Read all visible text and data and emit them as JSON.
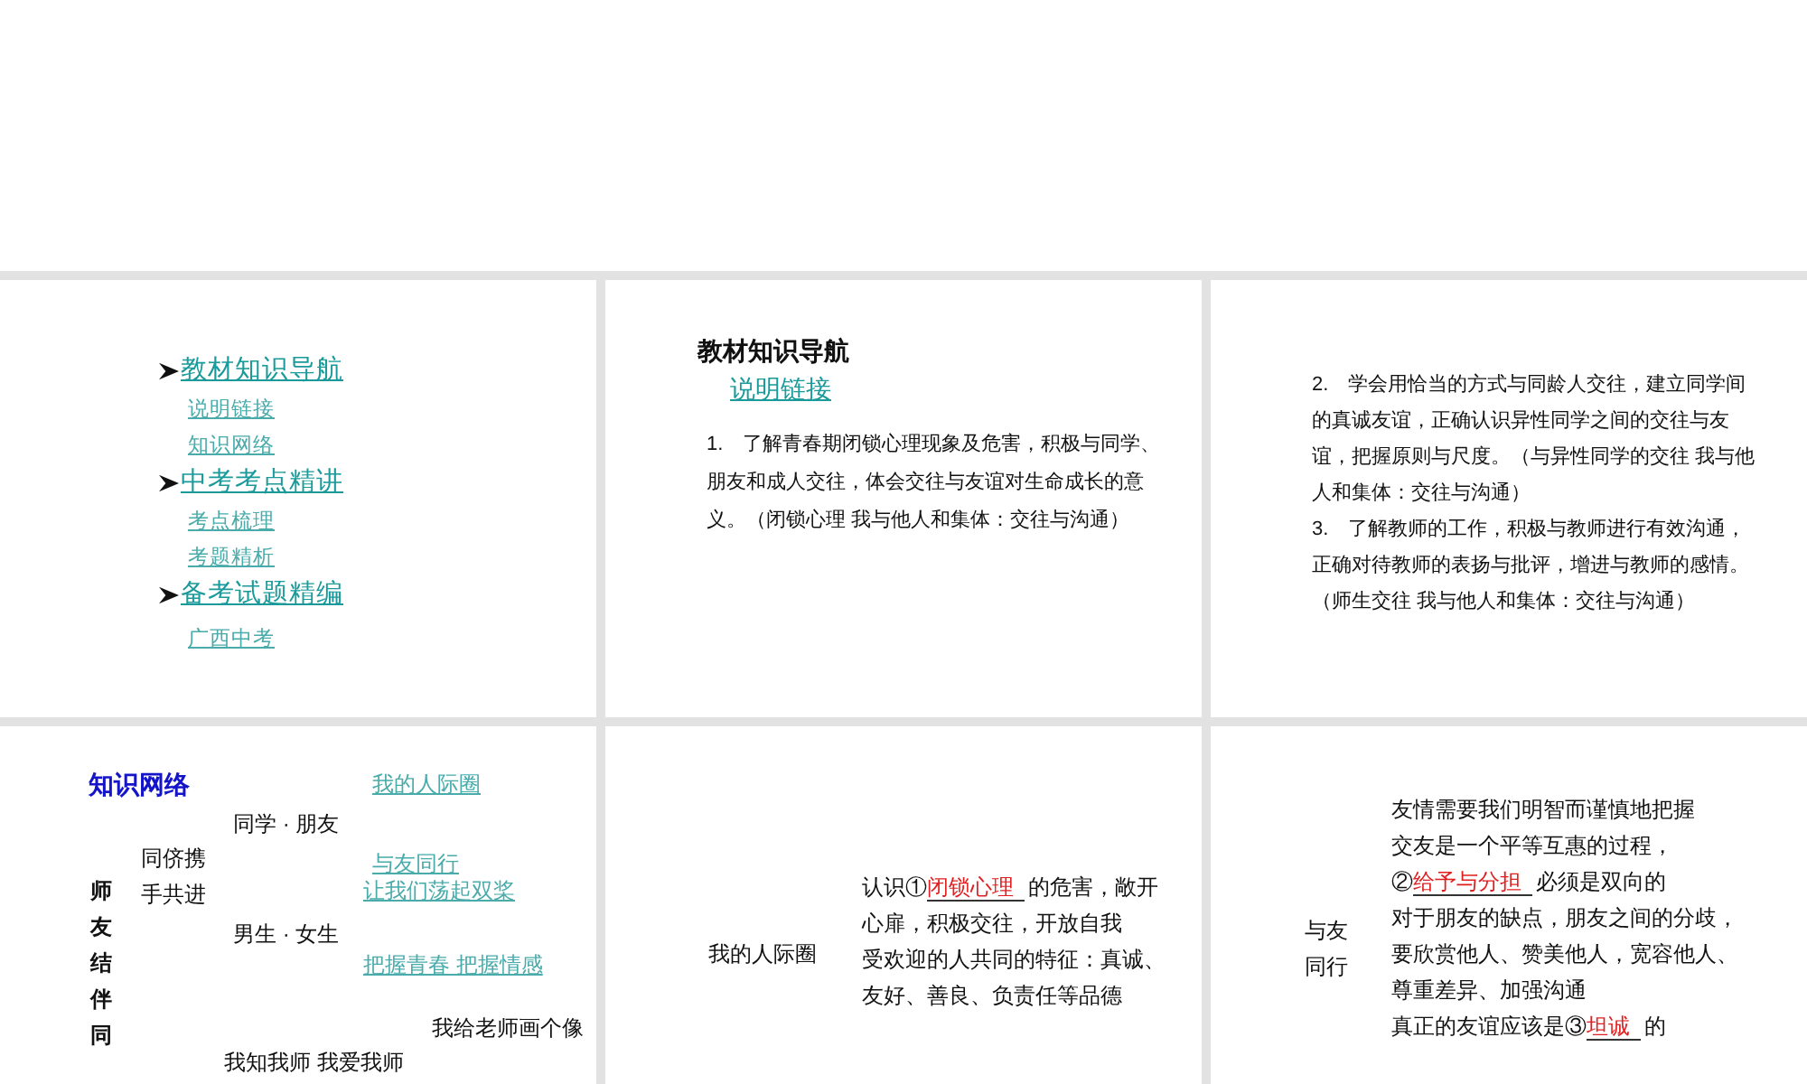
{
  "slides": [
    {
      "kind": "menu",
      "sections": [
        {
          "heading": "教材知识导航",
          "links": [
            "说明链接",
            "知识网络"
          ]
        },
        {
          "heading": "中考考点精讲",
          "links": [
            "考点梳理",
            "考题精析"
          ]
        },
        {
          "heading": "备考试题精编",
          "links": [
            "广西中考"
          ]
        }
      ]
    },
    {
      "kind": "text_page",
      "title": "教材知识导航",
      "link": "说明链接",
      "paragraphs": [
        "1.　了解青春期闭锁心理现象及危害，积极与同学、朋友和成人交往，体会交往与友谊对生命成长的意义。（闭锁心理 我与他人和集体：交往与沟通）"
      ]
    },
    {
      "kind": "text_page",
      "paragraphs": [
        "2.　学会用恰当的方式与同龄人交往，建立同学间的真诚友谊，正确认识异性同学之间的交往与友谊，把握原则与尺度。（与异性同学的交往 我与他人和集体：交往与沟通）",
        "3.　了解教师的工作，积极与教师进行有效沟通，正确对待教师的表扬与批评，增进与教师的感情。（师生交往 我与他人和集体：交往与沟通）"
      ]
    },
    {
      "kind": "network",
      "title": "知识网络",
      "root": "师友结伴同",
      "branch": [
        "同侪携",
        "手共进"
      ],
      "topics": [
        "同学 · 朋友",
        "男生 · 女生",
        "我知我师 我爱我师"
      ],
      "links": [
        "我的人际圈",
        "与友同行",
        "让我们荡起双桨",
        "把握青春 把握情感"
      ],
      "note": "我给老师画个像"
    },
    {
      "kind": "notes",
      "label": [
        "我的人际圈"
      ],
      "lines": [
        [
          {
            "text": "认识①"
          },
          {
            "text": "闭锁心理",
            "kind": "answer"
          },
          {
            "text": "的危害，敞开"
          }
        ],
        [
          {
            "text": "心扉，积极交往，开放自我"
          }
        ],
        [
          {
            "text": "受欢迎的人共同的特征：真诚、"
          }
        ],
        [
          {
            "text": "友好、善良、负责任等品德"
          }
        ]
      ]
    },
    {
      "kind": "notes",
      "label": [
        "与友",
        "同行"
      ],
      "lines": [
        [
          {
            "text": "友情需要我们明智而谨慎地把握"
          }
        ],
        [
          {
            "text": "交友是一个平等互惠的过程，"
          }
        ],
        [
          {
            "text": "②"
          },
          {
            "text": "给予与分担",
            "kind": "answer"
          },
          {
            "text": "必须是双向的"
          }
        ],
        [
          {
            "text": "对于朋友的缺点，朋友之间的分歧，"
          }
        ],
        [
          {
            "text": "要欣赏他人、赞美他人，宽容他人、"
          }
        ],
        [
          {
            "text": "尊重差异、加强沟通"
          }
        ],
        [
          {
            "text": "真正的友谊应该是③"
          },
          {
            "text": "坦诚",
            "kind": "answer"
          },
          {
            "text": "的"
          }
        ]
      ]
    }
  ]
}
